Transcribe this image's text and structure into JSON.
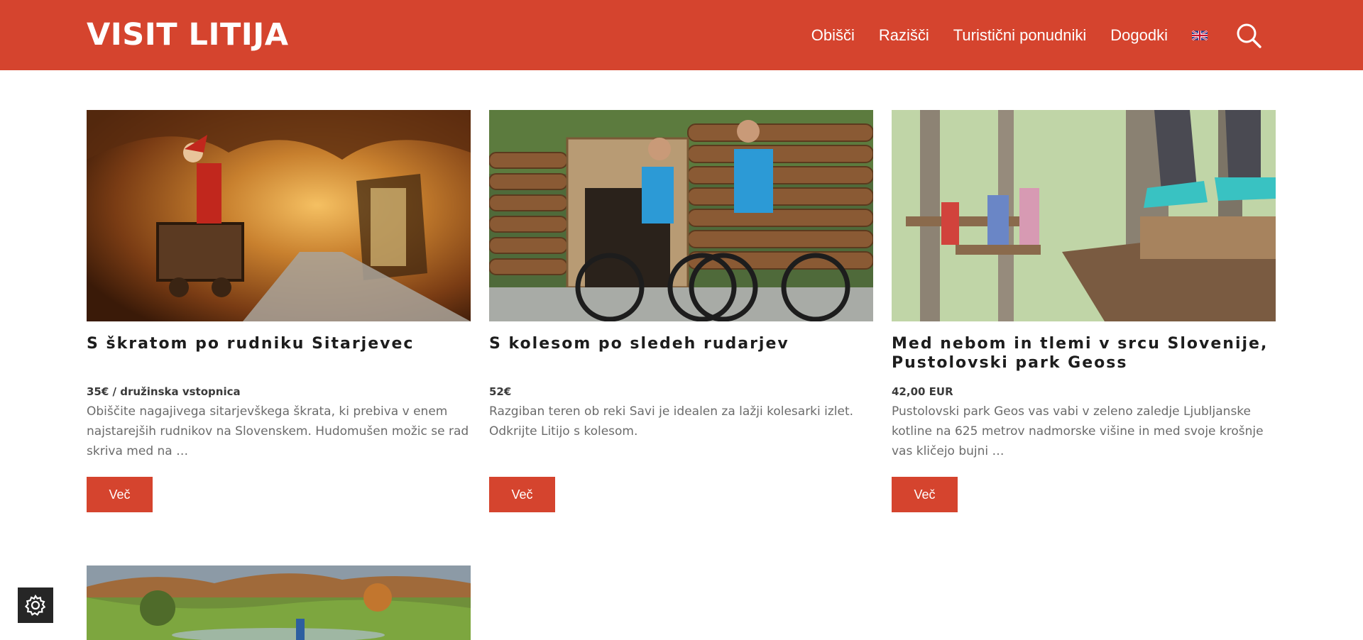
{
  "header": {
    "logo": "VISIT LITIJA",
    "nav": [
      "Obišči",
      "Razišči",
      "Turistični ponudniki",
      "Dogodki"
    ],
    "language_icon": "uk-flag-icon",
    "search_icon": "search-icon"
  },
  "cards": [
    {
      "title": "S škratom po rudniku Sitarjevec",
      "price": "35€ / družinska vstopnica",
      "description": "Obiščite nagajivega sitarjevškega škrata, ki prebiva v enem najstarejših rudnikov na Slovenskem. Hudomušen možic se rad skriva med na …",
      "button": "Več"
    },
    {
      "title": "S kolesom po sledeh rudarjev",
      "price": "52€",
      "description": "Razgiban teren ob reki Savi je idealen za lažji kolesarki izlet. Odkrijte Litijo s kolesom.",
      "button": "Več"
    },
    {
      "title": "Med nebom in tlemi v srcu Slovenije, Pustolovski park Geoss",
      "price": "42,00 EUR",
      "description": "Pustolovski park Geos vas vabi v zeleno zaledje Ljubljanske kotline na 625 metrov nadmorske višine in med svoje krošnje vas kličejo bujni …",
      "button": "Več"
    }
  ],
  "settings_icon": "gear-icon",
  "colors": {
    "brand": "#d5442e",
    "text": "#1d1d1d",
    "muted": "#6b6b6b",
    "settings_bg": "#262626"
  }
}
